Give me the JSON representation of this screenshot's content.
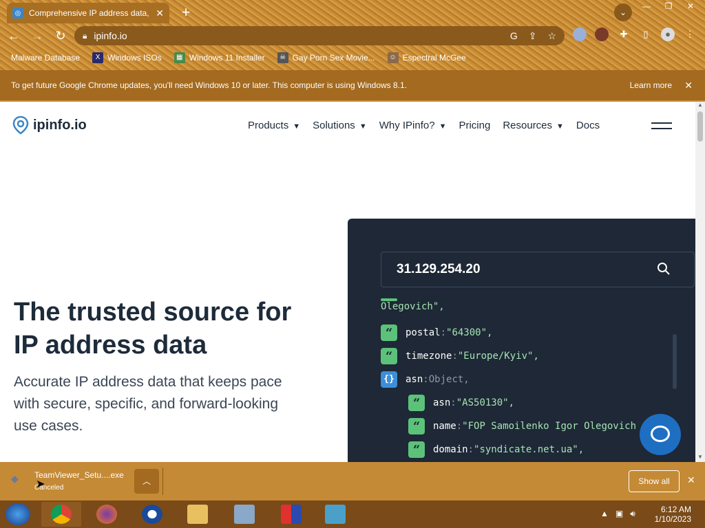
{
  "browser": {
    "tab_title": "Comprehensive IP address data, I",
    "tab_close": "✕",
    "new_tab": "+",
    "url": "ipinfo.io",
    "bookmarks": [
      {
        "label": "Malware Database"
      },
      {
        "label": "Windows ISOs"
      },
      {
        "label": "Windows 11 Installer"
      },
      {
        "label": "Gay Porn Sex Movie..."
      },
      {
        "label": "Espectral McGee"
      }
    ],
    "update_message": "To get future Google Chrome updates, you'll need Windows 10 or later. This computer is using Windows 8.1.",
    "learn_more": "Learn more",
    "close": "✕"
  },
  "site": {
    "logo_text": "ipinfo.io",
    "menu": [
      {
        "label": "Products",
        "has_chevron": true
      },
      {
        "label": "Solutions",
        "has_chevron": true
      },
      {
        "label": "Why IPinfo?",
        "has_chevron": true
      },
      {
        "label": "Pricing",
        "has_chevron": false
      },
      {
        "label": "Resources",
        "has_chevron": true
      },
      {
        "label": "Docs",
        "has_chevron": false
      }
    ],
    "hero_title": "The trusted source for IP address data",
    "hero_subtitle": "Accurate IP address data that keeps pace with secure, specific, and forward-looking use cases.",
    "demo": {
      "ip": "31.129.254.20",
      "lines": [
        {
          "indent": 0,
          "badge": "",
          "key": "",
          "value": "Olegovich\","
        },
        {
          "indent": 0,
          "badge": "str",
          "key": "postal",
          "value": "\"64300\","
        },
        {
          "indent": 0,
          "badge": "str",
          "key": "timezone",
          "value": "\"Europe/Kyiv\","
        },
        {
          "indent": 0,
          "badge": "obj",
          "key": "asn",
          "value": "Object,"
        },
        {
          "indent": 1,
          "badge": "str",
          "key": "asn",
          "value": "\"AS50130\","
        },
        {
          "indent": 1,
          "badge": "str",
          "key": "name",
          "value": "\"FOP Samoilenko Igor Olegovich"
        },
        {
          "indent": 1,
          "badge": "str",
          "key": "domain",
          "value": "\"syndicate.net.ua\","
        }
      ]
    }
  },
  "download": {
    "filename": "TeamViewer_Setu....exe",
    "status": "Canceled",
    "show_all": "Show all",
    "close": "✕"
  },
  "taskbar": {
    "time": "6:12 AM",
    "date": "1/10/2023"
  },
  "colors": {
    "page_accent": "#1e2836",
    "green_badge": "#5cc27a",
    "blue_badge": "#3d8ed8",
    "chrome_bg": "#c78c34"
  }
}
